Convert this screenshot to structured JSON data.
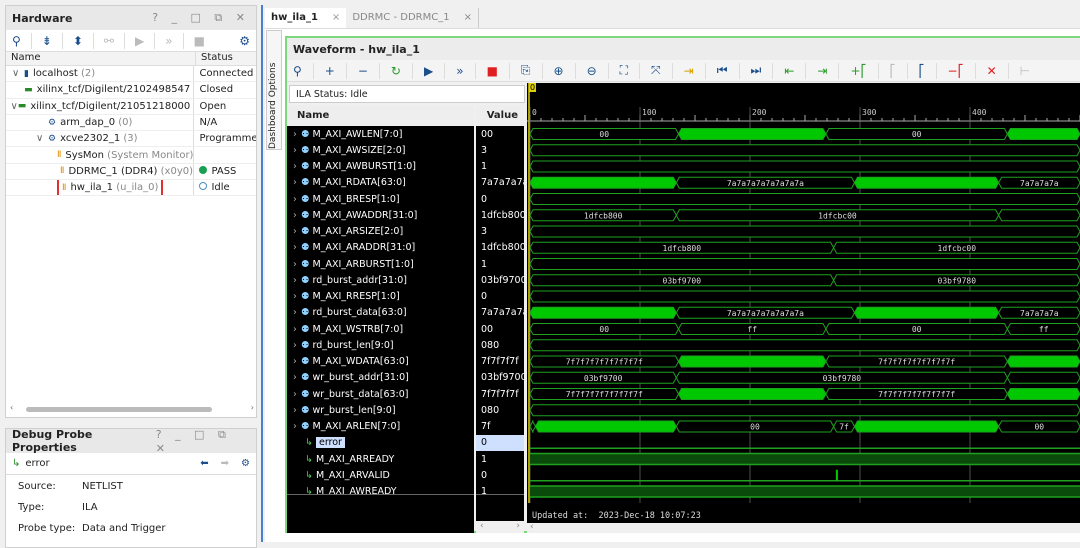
{
  "hardware": {
    "title": "Hardware",
    "controls": "? _ □ ⧉ ✕",
    "col_name": "Name",
    "col_status": "Status",
    "rows": [
      {
        "indent": 0,
        "arrow": "∨",
        "icon": "server-icon",
        "name": "localhost",
        "extra": "(2)",
        "status": "Connected"
      },
      {
        "indent": 1,
        "arrow": "",
        "icon": "jtag-target-icon",
        "name": "xilinx_tcf/Digilent/2102498547",
        "extra": "",
        "status": "Closed"
      },
      {
        "indent": 1,
        "arrow": "∨",
        "icon": "jtag-target-icon",
        "name": "xilinx_tcf/Digilent/21051218000",
        "extra": "",
        "status": "Open"
      },
      {
        "indent": 2,
        "arrow": "",
        "icon": "chip-icon",
        "name": "arm_dap_0",
        "extra": "(0)",
        "status": "N/A"
      },
      {
        "indent": 2,
        "arrow": "∨",
        "icon": "chip-icon",
        "name": "xcve2302_1",
        "extra": "(3)",
        "status": "Programmed"
      },
      {
        "indent": 3,
        "arrow": "",
        "icon": "core-icon",
        "name": "SysMon",
        "extra": "(System Monitor)",
        "status": ""
      },
      {
        "indent": 3,
        "arrow": "",
        "icon": "core-icon",
        "name": "DDRMC_1 (DDR4)",
        "extra": "(x0y0)",
        "status": "PASS",
        "status_icon": "green-dot"
      },
      {
        "indent": 3,
        "arrow": "",
        "icon": "core-icon",
        "name": "hw_ila_1",
        "extra": "(u_ila_0)",
        "status": "Idle",
        "status_icon": "empty-circle",
        "highlighted": true
      }
    ]
  },
  "probe_props": {
    "title": "Debug Probe Properties",
    "controls": "? _ □ ⧉ ✕",
    "probe": "error",
    "props": [
      {
        "k": "Source:",
        "v": "NETLIST"
      },
      {
        "k": "Type:",
        "v": "ILA"
      },
      {
        "k": "Probe type:",
        "v": "Data and Trigger"
      }
    ]
  },
  "tabs": [
    {
      "label": "hw_ila_1",
      "active": true
    },
    {
      "label": "DDRMC - DDRMC_1",
      "active": false
    }
  ],
  "side_tab": "Dashboard Options",
  "waveform": {
    "title": "Waveform - hw_ila_1",
    "ila_status": "ILA Status: Idle",
    "col_name": "Name",
    "col_value": "Value",
    "cursor_label": "0",
    "updated": "Updated at:  2023-Dec-18 10:07:23",
    "colors": {
      "bus_fill": "#00c800",
      "line": "#1fa01f",
      "high_fill": "#0a4a0a"
    },
    "time_ticks": [
      0,
      100,
      200,
      300,
      400
    ],
    "time_max": 500,
    "signals": [
      {
        "name": "M_AXI_AWLEN[7:0]",
        "value": "00",
        "type": "bus",
        "segs": [
          [
            0,
            135,
            "00"
          ],
          [
            135,
            269,
            "#"
          ],
          [
            269,
            434,
            "00"
          ],
          [
            434,
            500,
            "#"
          ]
        ]
      },
      {
        "name": "M_AXI_AWSIZE[2:0]",
        "value": "3",
        "type": "bus",
        "segs": [
          [
            0,
            500,
            ""
          ]
        ]
      },
      {
        "name": "M_AXI_AWBURST[1:0]",
        "value": "1",
        "type": "bus",
        "segs": [
          [
            0,
            500,
            ""
          ]
        ]
      },
      {
        "name": "M_AXI_RDATA[63:0]",
        "value": "7a7a7a7a",
        "type": "bus",
        "segs": [
          [
            0,
            133,
            "#"
          ],
          [
            133,
            295,
            "7a7a7a7a7a7a7a7a"
          ],
          [
            295,
            426,
            "#"
          ],
          [
            426,
            500,
            "7a7a7a7a"
          ]
        ]
      },
      {
        "name": "M_AXI_BRESP[1:0]",
        "value": "0",
        "type": "bus",
        "segs": [
          [
            0,
            500,
            ""
          ]
        ]
      },
      {
        "name": "M_AXI_AWADDR[31:0]",
        "value": "1dfcb800",
        "type": "bus",
        "segs": [
          [
            0,
            133,
            "1dfcb800"
          ],
          [
            133,
            426,
            "1dfcbc00"
          ],
          [
            426,
            500,
            ""
          ]
        ]
      },
      {
        "name": "M_AXI_ARSIZE[2:0]",
        "value": "3",
        "type": "bus",
        "segs": [
          [
            0,
            500,
            ""
          ]
        ]
      },
      {
        "name": "M_AXI_ARADDR[31:0]",
        "value": "1dfcb800",
        "type": "bus",
        "segs": [
          [
            0,
            276,
            "1dfcb800"
          ],
          [
            276,
            500,
            "1dfcbc00"
          ]
        ]
      },
      {
        "name": "M_AXI_ARBURST[1:0]",
        "value": "1",
        "type": "bus",
        "segs": [
          [
            0,
            500,
            ""
          ]
        ]
      },
      {
        "name": "rd_burst_addr[31:0]",
        "value": "03bf9700",
        "type": "bus",
        "segs": [
          [
            0,
            276,
            "03bf9700"
          ],
          [
            276,
            500,
            "03bf9780"
          ]
        ]
      },
      {
        "name": "M_AXI_RRESP[1:0]",
        "value": "0",
        "type": "bus",
        "segs": [
          [
            0,
            500,
            ""
          ]
        ]
      },
      {
        "name": "rd_burst_data[63:0]",
        "value": "7a7a7a7a",
        "type": "bus",
        "segs": [
          [
            0,
            133,
            "#"
          ],
          [
            133,
            295,
            "7a7a7a7a7a7a7a7a"
          ],
          [
            295,
            426,
            "#"
          ],
          [
            426,
            500,
            "7a7a7a7a"
          ]
        ]
      },
      {
        "name": "M_AXI_WSTRB[7:0]",
        "value": "00",
        "type": "bus",
        "segs": [
          [
            0,
            135,
            "00"
          ],
          [
            135,
            269,
            "ff"
          ],
          [
            269,
            434,
            "00"
          ],
          [
            434,
            500,
            "ff"
          ]
        ]
      },
      {
        "name": "rd_burst_len[9:0]",
        "value": "080",
        "type": "bus",
        "segs": [
          [
            0,
            500,
            ""
          ]
        ]
      },
      {
        "name": "M_AXI_WDATA[63:0]",
        "value": "7f7f7f7f",
        "type": "bus",
        "segs": [
          [
            0,
            135,
            "7f7f7f7f7f7f7f7f"
          ],
          [
            135,
            269,
            "#"
          ],
          [
            269,
            434,
            "7f7f7f7f7f7f7f7f"
          ],
          [
            434,
            500,
            "#"
          ]
        ]
      },
      {
        "name": "wr_burst_addr[31:0]",
        "value": "03bf9700",
        "type": "bus",
        "segs": [
          [
            0,
            133,
            "03bf9700"
          ],
          [
            133,
            434,
            "03bf9780"
          ],
          [
            434,
            500,
            ""
          ]
        ]
      },
      {
        "name": "wr_burst_data[63:0]",
        "value": "7f7f7f7f",
        "type": "bus",
        "segs": [
          [
            0,
            135,
            "7f7f7f7f7f7f7f7f"
          ],
          [
            135,
            269,
            "#"
          ],
          [
            269,
            434,
            "7f7f7f7f7f7f7f7f"
          ],
          [
            434,
            500,
            "#"
          ]
        ]
      },
      {
        "name": "wr_burst_len[9:0]",
        "value": "080",
        "type": "bus",
        "segs": [
          [
            0,
            500,
            ""
          ]
        ]
      },
      {
        "name": "M_AXI_ARLEN[7:0]",
        "value": "7f",
        "type": "bus",
        "segs": [
          [
            0,
            5,
            ""
          ],
          [
            5,
            133,
            "#"
          ],
          [
            133,
            276,
            "00"
          ],
          [
            276,
            295,
            "7f"
          ],
          [
            295,
            426,
            "#"
          ],
          [
            426,
            500,
            "00"
          ]
        ]
      },
      {
        "name": "error",
        "value": "0",
        "type": "bit",
        "level": 0,
        "selected": true
      },
      {
        "name": "M_AXI_ARREADY",
        "value": "1",
        "type": "bit",
        "level": 1
      },
      {
        "name": "M_AXI_ARVALID",
        "value": "0",
        "type": "bit",
        "level": 0,
        "pulses": [
          279
        ]
      },
      {
        "name": "M_AXI_AWREADY",
        "value": "1",
        "type": "bit",
        "level": 1
      }
    ]
  }
}
